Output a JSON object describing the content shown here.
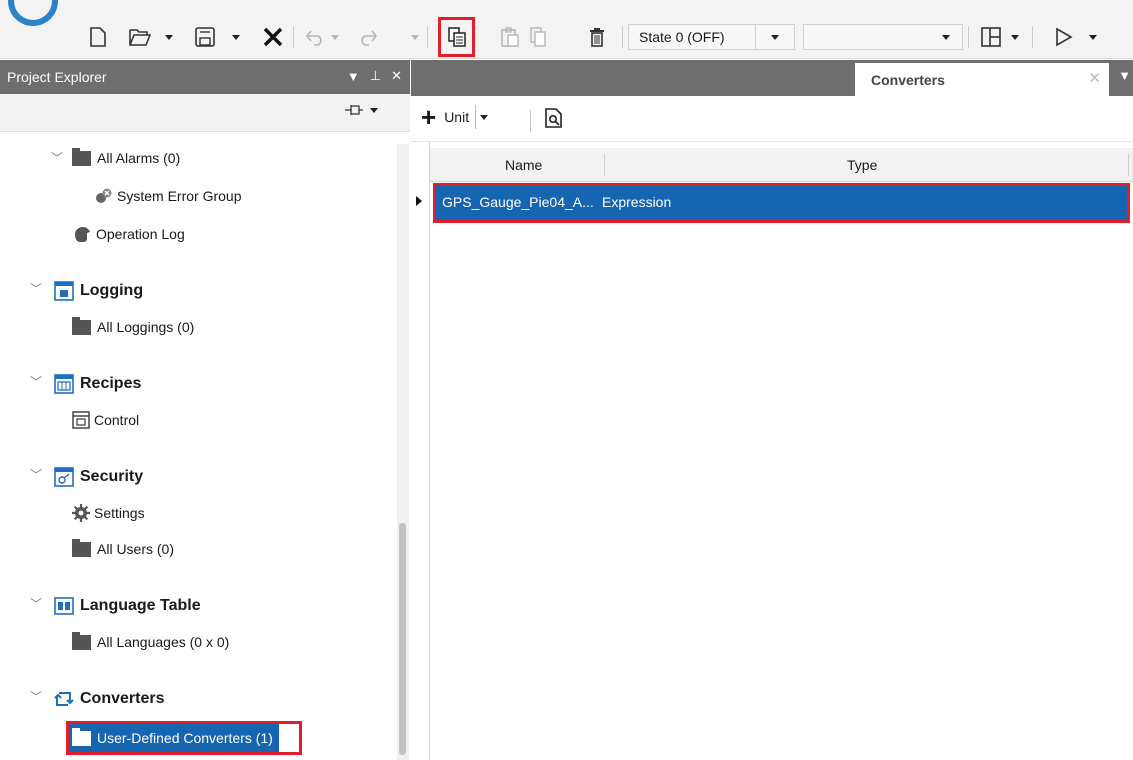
{
  "toolbar": {
    "state_combo_value": "State 0 (OFF)",
    "second_combo_value": "",
    "icons": [
      "new-file-icon",
      "open-icon",
      "save-icon",
      "delete-x-icon",
      "undo-icon",
      "redo-icon",
      "copy-icon",
      "paste-icon",
      "duplicate-icon",
      "trash-icon",
      "layout-icon",
      "run-icon"
    ],
    "highlight_color": "#e21e2b"
  },
  "explorer": {
    "title": "Project Explorer",
    "tree": {
      "all_alarms": "All Alarms (0)",
      "system_error_group": "System Error Group",
      "operation_log": "Operation Log",
      "logging": "Logging",
      "all_loggings": "All Loggings (0)",
      "recipes": "Recipes",
      "control": "Control",
      "security": "Security",
      "settings": "Settings",
      "all_users": "All Users (0)",
      "language_table": "Language Table",
      "all_languages": "All Languages (0 x 0)",
      "converters": "Converters",
      "user_defined_converters": "User-Defined Converters (1)"
    },
    "selection_color": "#1565b0"
  },
  "panel": {
    "tab_title": "Converters",
    "add_unit_label": "Unit",
    "columns": [
      "Name",
      "Type"
    ],
    "rows": [
      {
        "name": "GPS_Gauge_Pie04_A...",
        "type": "Expression"
      }
    ]
  }
}
